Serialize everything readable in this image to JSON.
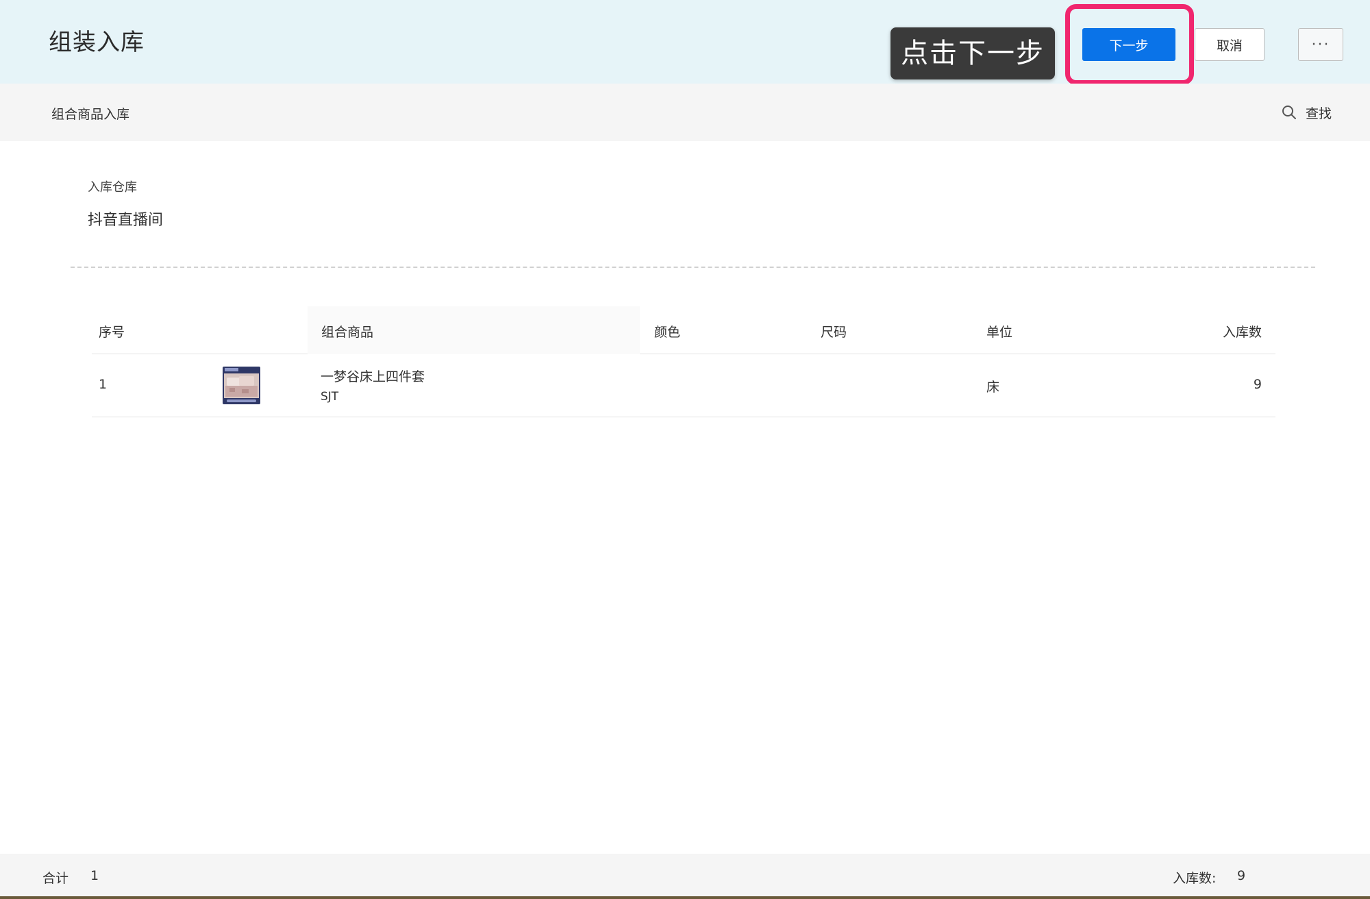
{
  "header": {
    "title": "组装入库",
    "next_label": "下一步",
    "cancel_label": "取消",
    "more_label": "···",
    "tooltip": "点击下一步",
    "highlight_color": "#f0266e",
    "primary_color": "#0a73e8"
  },
  "subbar": {
    "title": "组合商品入库",
    "search_label": "查找"
  },
  "warehouse": {
    "label": "入库仓库",
    "value": "抖音直播间"
  },
  "table": {
    "headers": {
      "index": "序号",
      "product": "组合商品",
      "color": "颜色",
      "size": "尺码",
      "unit": "单位",
      "qty": "入库数"
    },
    "rows": [
      {
        "index": "1",
        "name": "一梦谷床上四件套",
        "code": "SJT",
        "color": "",
        "size": "",
        "unit": "床",
        "qty": "9"
      }
    ]
  },
  "footer": {
    "total_label": "合计",
    "total_value": "1",
    "qty_label": "入库数:",
    "qty_value": "9"
  }
}
